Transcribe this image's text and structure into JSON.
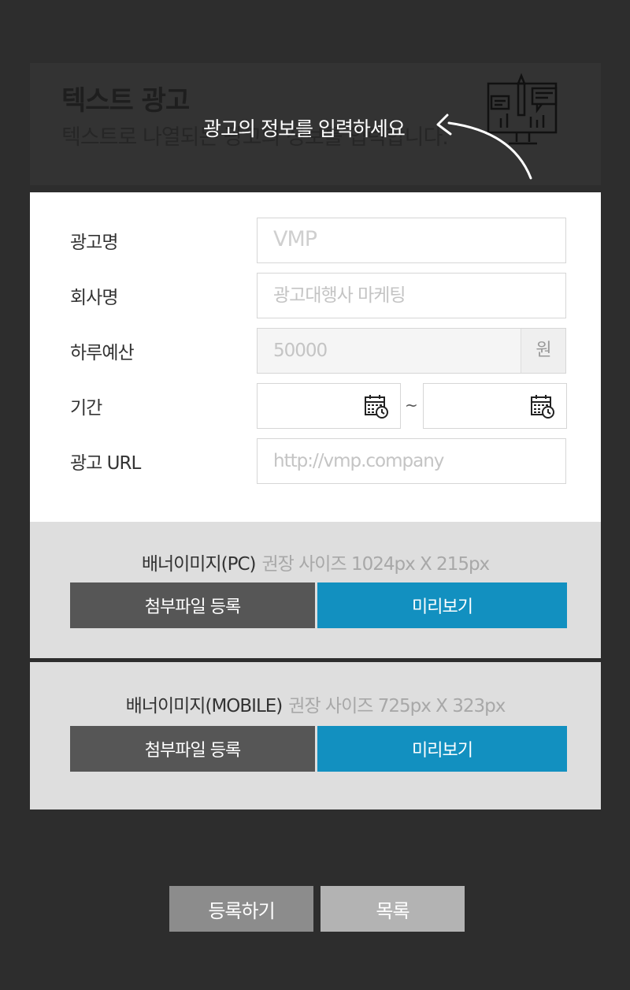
{
  "underlay": {
    "title": "텍스트 광고",
    "subtitle": "텍스트로 나열되는 광고의 정보를 입력합니다."
  },
  "guide": {
    "text": "광고의 정보를 입력하세요"
  },
  "form": {
    "ad_name": {
      "label": "광고명",
      "placeholder": "VMP"
    },
    "company": {
      "label": "회사명",
      "placeholder": "광고대행사 마케팅"
    },
    "budget": {
      "label": "하루예산",
      "placeholder": "50000",
      "unit": "원"
    },
    "period": {
      "label": "기간",
      "separator": "~"
    },
    "url": {
      "label": "광고 URL",
      "placeholder": "http://vmp.company"
    }
  },
  "banner_pc": {
    "title": "배너이미지(PC)",
    "hint": "권장 사이즈 1024px X 215px",
    "attach_label": "첨부파일 등록",
    "preview_label": "미리보기"
  },
  "banner_mobile": {
    "title": "배너이미지(MOBILE)",
    "hint": "권장 사이즈 725px X 323px",
    "attach_label": "첨부파일 등록",
    "preview_label": "미리보기"
  },
  "actions": {
    "register_label": "등록하기",
    "list_label": "목록"
  },
  "colors": {
    "overlay": "#2d2d2d",
    "accent": "#1290c0",
    "attach_button": "#565656",
    "register_button": "#8c8c8c",
    "list_button": "#b3b3b3"
  }
}
